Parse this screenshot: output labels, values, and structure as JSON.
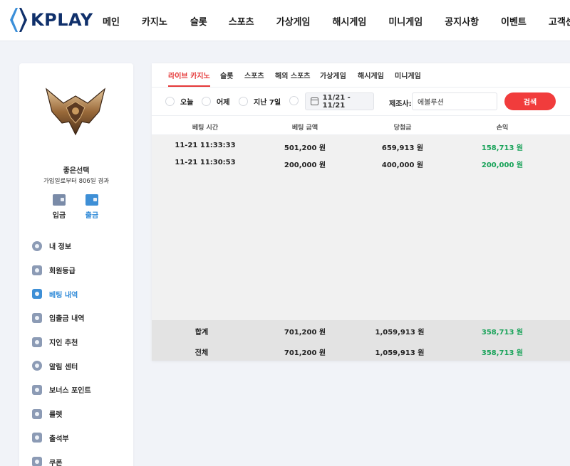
{
  "brand": {
    "name": "KPLAY"
  },
  "nav": [
    "메인",
    "카지노",
    "슬롯",
    "스포츠",
    "가상게임",
    "해시게임",
    "미니게임",
    "공지사항",
    "이벤트",
    "고객센터"
  ],
  "user": {
    "name": "좋은선택",
    "since": "가입일로부터 806일 경과"
  },
  "wallet": {
    "deposit": "입금",
    "withdraw": "출금"
  },
  "menu": [
    {
      "label": "내 정보",
      "icon": "profile-icon"
    },
    {
      "label": "회원등급",
      "icon": "shield-icon"
    },
    {
      "label": "베팅 내역",
      "icon": "document-icon",
      "active": true
    },
    {
      "label": "입출금 내역",
      "icon": "wallet-icon"
    },
    {
      "label": "지인 추천",
      "icon": "heart-icon"
    },
    {
      "label": "알림 센터",
      "icon": "chat-icon"
    },
    {
      "label": "보너스 포인트",
      "icon": "card-icon"
    },
    {
      "label": "룰렛",
      "icon": "roulette-icon"
    },
    {
      "label": "출석부",
      "icon": "calendar-check-icon"
    },
    {
      "label": "쿠폰",
      "icon": "coupon-icon"
    }
  ],
  "tabs": [
    "라이브 카지노",
    "슬롯",
    "스포츠",
    "해외 스포츠",
    "가상게임",
    "해시게임",
    "미니게임"
  ],
  "filters": {
    "radios": [
      "오늘",
      "어제",
      "지난 7일"
    ],
    "date_range": "11/21 - 11/21",
    "maker_label": "제조사:",
    "maker_value": "에볼루션",
    "search_label": "검색"
  },
  "table": {
    "headers": [
      "베팅 시간",
      "베팅 금액",
      "당첨금",
      "손익"
    ],
    "rows": [
      [
        "11-21 11:33:33",
        "501,200 원",
        "659,913 원",
        "158,713 원"
      ],
      [
        "11-21 11:30:53",
        "200,000 원",
        "400,000 원",
        "200,000 원"
      ]
    ],
    "totals": [
      [
        "합계",
        "701,200 원",
        "1,059,913 원",
        "358,713 원"
      ],
      [
        "전체",
        "701,200 원",
        "1,059,913 원",
        "358,713 원"
      ]
    ]
  },
  "colors": {
    "accent": "#e53838",
    "active": "#2f8ad8",
    "positive": "#1aa35a"
  }
}
